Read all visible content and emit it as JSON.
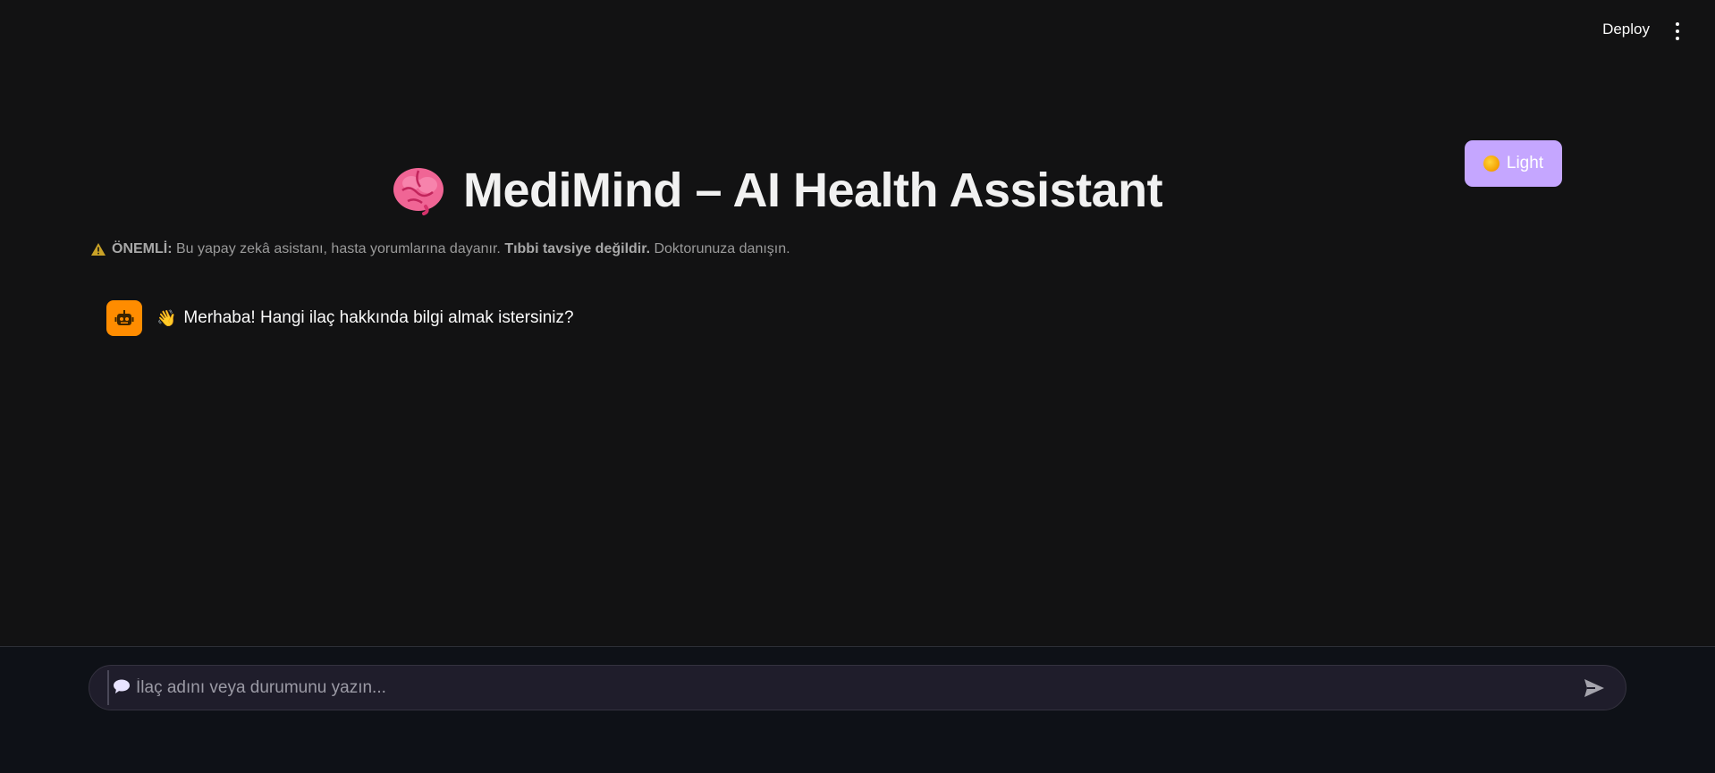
{
  "header": {
    "deploy_label": "Deploy",
    "menu_icon": "kebab-menu-icon"
  },
  "theme_toggle": {
    "icon": "sun-icon",
    "label": "Light",
    "background_color": "#c5a6ff"
  },
  "title": {
    "icon": "brain-icon",
    "text": "MediMind – AI Health Assistant"
  },
  "warning": {
    "icon": "warning-icon",
    "prefix_bold": "ÖNEMLİ:",
    "text_1": " Bu yapay zekâ asistanı, hasta yorumlarına dayanır. ",
    "bold_2": "Tıbbi tavsiye değildir.",
    "text_3": " Doktorunuza danışın."
  },
  "messages": [
    {
      "role": "assistant",
      "avatar_icon": "robot-icon",
      "avatar_color": "#ff8c00",
      "emoji": "👋",
      "text": "Merhaba! Hangi ilaç hakkında bilgi almak istersiniz?"
    }
  ],
  "chat_input": {
    "icon": "speech-bubble-icon",
    "placeholder": "İlaç adını veya durumunu yazın...",
    "value": "",
    "send_icon": "send-icon"
  }
}
